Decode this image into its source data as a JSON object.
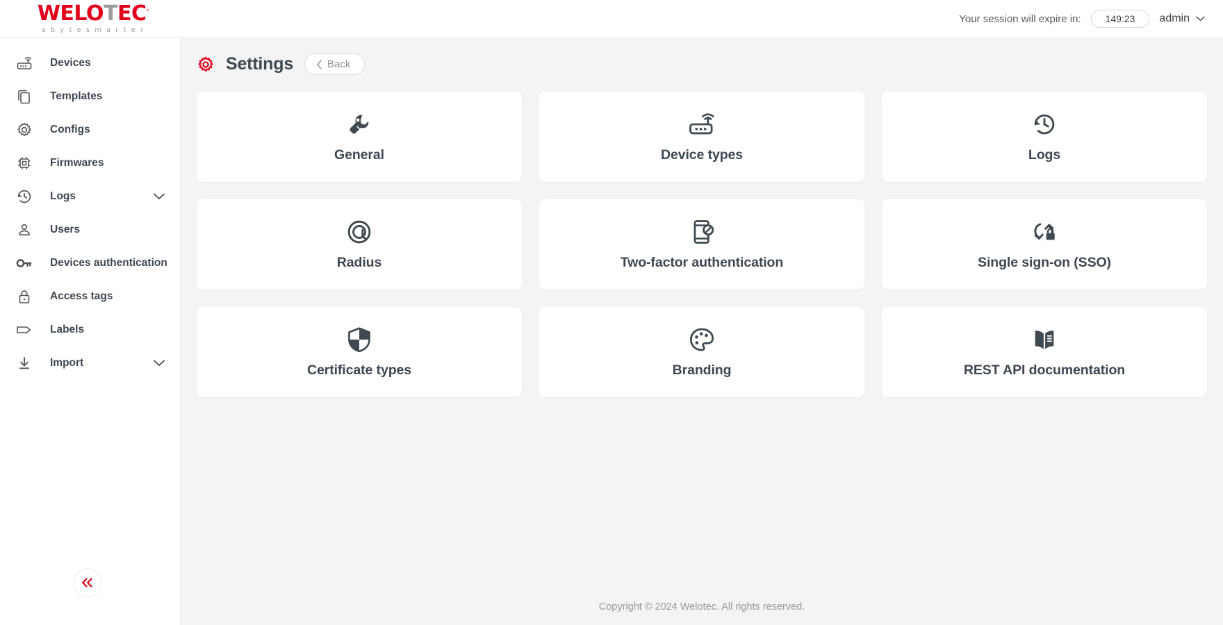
{
  "topbar": {
    "logo": {
      "text_red_1": "WELO",
      "text_gray": "T",
      "text_red_2": "EC",
      "trademark": "·",
      "tagline": "a b y t e   s m a r t e r"
    },
    "session_label": "Your session will expire in:",
    "session_time": "149:23",
    "user_name": "admin"
  },
  "sidebar": {
    "items": [
      {
        "label": "Devices",
        "icon": "router-icon",
        "has_chevron": false
      },
      {
        "label": "Templates",
        "icon": "copy-icon",
        "has_chevron": false
      },
      {
        "label": "Configs",
        "icon": "gear-icon",
        "has_chevron": false
      },
      {
        "label": "Firmwares",
        "icon": "chip-icon",
        "has_chevron": false
      },
      {
        "label": "Logs",
        "icon": "history-icon",
        "has_chevron": true
      },
      {
        "label": "Users",
        "icon": "user-icon",
        "has_chevron": false
      },
      {
        "label": "Devices authentication",
        "icon": "key-icon",
        "has_chevron": false
      },
      {
        "label": "Access tags",
        "icon": "lock-icon",
        "has_chevron": false
      },
      {
        "label": "Labels",
        "icon": "tag-icon",
        "has_chevron": false
      },
      {
        "label": "Import",
        "icon": "download-icon",
        "has_chevron": true
      }
    ],
    "collapse_label": "«"
  },
  "page": {
    "title": "Settings",
    "title_icon": "gear-icon",
    "back_label": "Back",
    "cards": [
      {
        "label": "General",
        "icon": "wrench-icon"
      },
      {
        "label": "Device types",
        "icon": "router-icon"
      },
      {
        "label": "Logs",
        "icon": "history-icon"
      },
      {
        "label": "Radius",
        "icon": "at-circle-icon"
      },
      {
        "label": "Two-factor authentication",
        "icon": "phone-block-icon"
      },
      {
        "label": "Single sign-on (SSO)",
        "icon": "sso-lock-icon"
      },
      {
        "label": "Certificate types",
        "icon": "shield-icon"
      },
      {
        "label": "Branding",
        "icon": "palette-icon"
      },
      {
        "label": "REST API documentation",
        "icon": "book-icon"
      }
    ]
  },
  "footer": {
    "copyright": "Copyright © 2024 Welotec. All rights reserved."
  },
  "colors": {
    "brand_red": "#e2001a",
    "text_dark": "#3d4852",
    "bg": "#f4f4f4",
    "card_bg": "#ffffff"
  }
}
